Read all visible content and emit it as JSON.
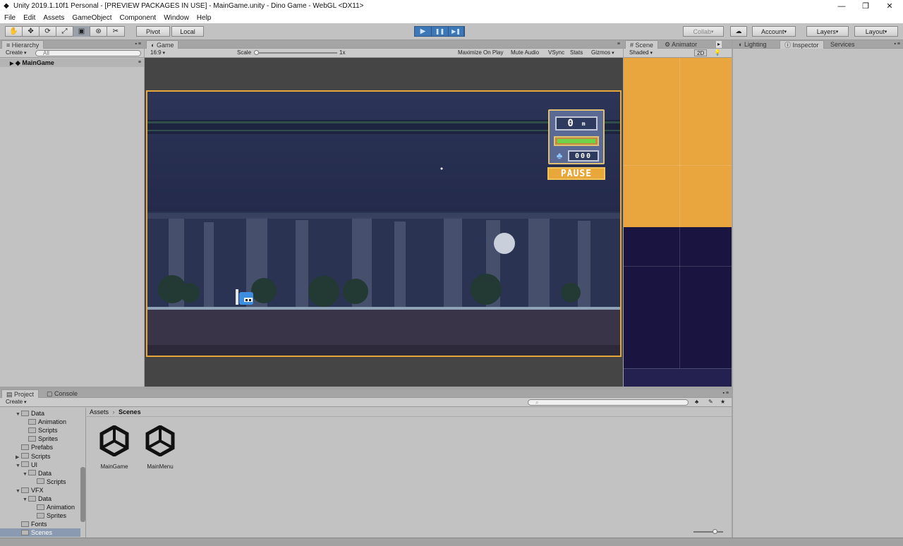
{
  "window": {
    "title": "Unity 2019.1.10f1 Personal - [PREVIEW PACKAGES IN USE] - MainGame.unity - Dino Game - WebGL <DX11>",
    "controls": {
      "minimize": "—",
      "maximize": "❐",
      "close": "✕"
    }
  },
  "menu": [
    "File",
    "Edit",
    "Assets",
    "GameObject",
    "Component",
    "Window",
    "Help"
  ],
  "toolbar": {
    "tools": [
      "✋",
      "✥",
      "⟳",
      "⤢",
      "▣",
      "⊛",
      "✂"
    ],
    "pivot": "Pivot",
    "local": "Local",
    "play_buttons": [
      "▶",
      "❚❚",
      "▶❚"
    ],
    "collab": "Collab",
    "cloud_icon": "☁",
    "account": "Account",
    "layers": "Layers",
    "layout": "Layout"
  },
  "hierarchy": {
    "tab": "Hierarchy",
    "create": "Create",
    "search_placeholder": "All",
    "root_item": "MainGame"
  },
  "game": {
    "tab": "Game",
    "aspect": "16:9",
    "scale_label": "Scale",
    "scale_value": "1x",
    "scale_fraction": 0.0,
    "toggles": [
      "Maximize On Play",
      "Mute Audio",
      "VSync",
      "Stats",
      "Gizmos"
    ],
    "hud": {
      "distance": "0",
      "distance_unit": "m",
      "health_fraction": 1.0,
      "potion_count": "000",
      "pause_label": "PAUSE"
    }
  },
  "scene": {
    "tabs": [
      "Scene",
      "Animator"
    ],
    "shading": "Shaded",
    "mode_2d": "2D"
  },
  "inspector": {
    "tabs": [
      "Lighting",
      "Inspector",
      "Services"
    ]
  },
  "project": {
    "tabs": [
      "Project",
      "Console"
    ],
    "create": "Create",
    "breadcrumb_root": "Assets",
    "breadcrumb_current": "Scenes",
    "tree": [
      {
        "label": "Data",
        "depth": 1,
        "expanded": true
      },
      {
        "label": "Animation",
        "depth": 2
      },
      {
        "label": "Scripts",
        "depth": 2
      },
      {
        "label": "Sprites",
        "depth": 2
      },
      {
        "label": "Prefabs",
        "depth": 1
      },
      {
        "label": "Scripts",
        "depth": 1,
        "collapsed": true
      },
      {
        "label": "UI",
        "depth": 1,
        "expanded": true
      },
      {
        "label": "Data",
        "depth": 2,
        "expanded": true
      },
      {
        "label": "Scripts",
        "depth": 3
      },
      {
        "label": "VFX",
        "depth": 1,
        "expanded": true
      },
      {
        "label": "Data",
        "depth": 2,
        "expanded": true
      },
      {
        "label": "Animation",
        "depth": 3
      },
      {
        "label": "Sprites",
        "depth": 3
      },
      {
        "label": "Fonts",
        "depth": 1
      },
      {
        "label": "Scenes",
        "depth": 1,
        "selected": true
      }
    ],
    "assets": [
      "MainGame",
      "MainMenu"
    ]
  },
  "colors": {
    "editor_bg": "#c2c2c2",
    "tab_bg": "#a5a5a5",
    "play_blue": "#3d77b5",
    "game_frame": "#e8a73a",
    "scene_orange": "#e9a53e",
    "scene_navy": "#1a1540"
  }
}
